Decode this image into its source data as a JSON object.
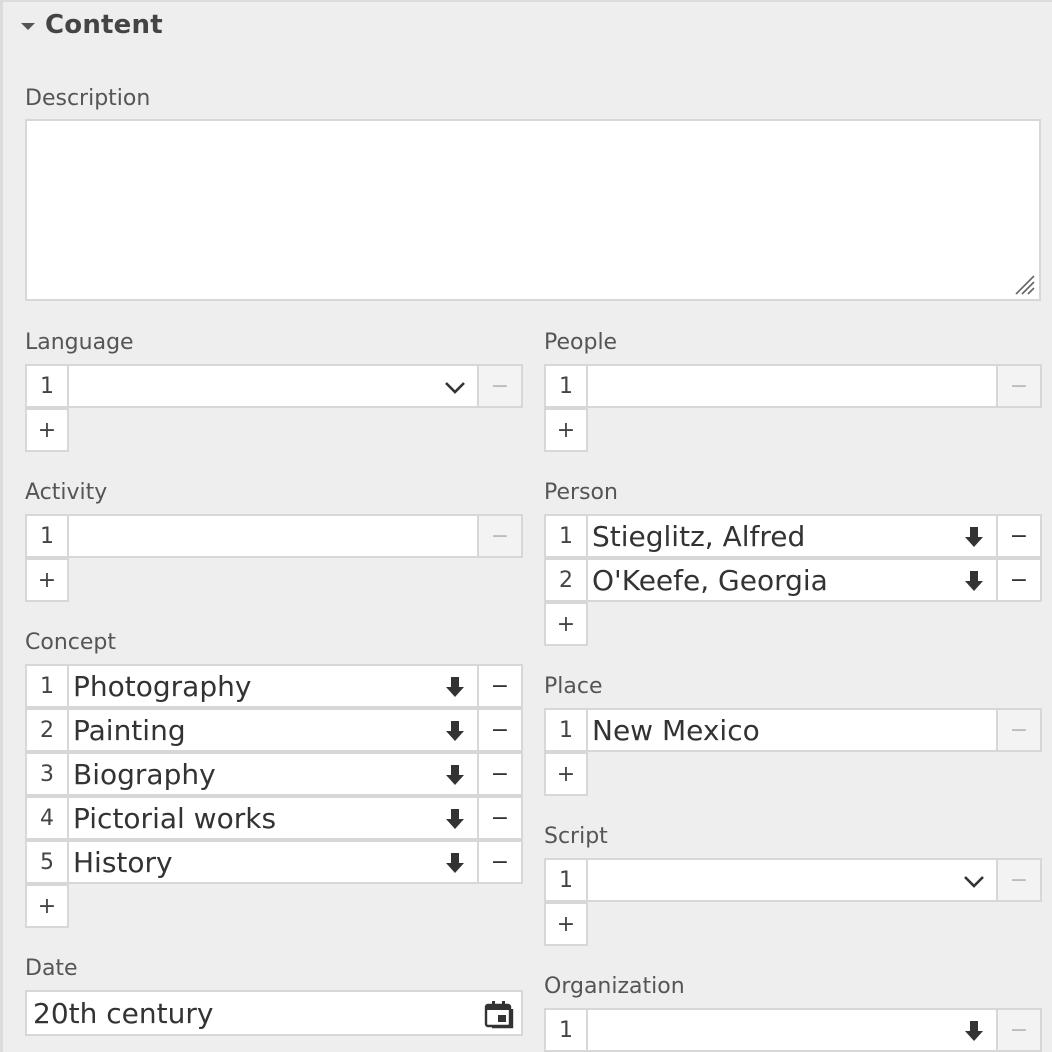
{
  "section": {
    "title": "Content"
  },
  "labels": {
    "description": "Description",
    "language": "Language",
    "people": "People",
    "activity": "Activity",
    "person": "Person",
    "concept": "Concept",
    "place": "Place",
    "script": "Script",
    "date": "Date",
    "organization": "Organization"
  },
  "description": {
    "value": ""
  },
  "language": {
    "rows": [
      {
        "n": "1",
        "value": ""
      }
    ],
    "add": "+",
    "remove": "−"
  },
  "people": {
    "rows": [
      {
        "n": "1",
        "value": ""
      }
    ],
    "add": "+",
    "remove": "−"
  },
  "activity": {
    "rows": [
      {
        "n": "1",
        "value": ""
      }
    ],
    "add": "+",
    "remove": "−"
  },
  "person": {
    "rows": [
      {
        "n": "1",
        "value": "Stieglitz, Alfred"
      },
      {
        "n": "2",
        "value": "O'Keefe, Georgia"
      }
    ],
    "add": "+",
    "remove": "−"
  },
  "concept": {
    "rows": [
      {
        "n": "1",
        "value": "Photography"
      },
      {
        "n": "2",
        "value": "Painting"
      },
      {
        "n": "3",
        "value": "Biography"
      },
      {
        "n": "4",
        "value": "Pictorial works"
      },
      {
        "n": "5",
        "value": "History"
      }
    ],
    "add": "+",
    "remove": "−"
  },
  "place": {
    "rows": [
      {
        "n": "1",
        "value": "New Mexico"
      }
    ],
    "add": "+",
    "remove": "−"
  },
  "script": {
    "rows": [
      {
        "n": "1",
        "value": ""
      }
    ],
    "add": "+",
    "remove": "−"
  },
  "date": {
    "value": "20th century"
  },
  "organization": {
    "rows": [
      {
        "n": "1",
        "value": ""
      }
    ],
    "remove": "−"
  },
  "icons": {
    "caret": "caret-down-icon",
    "dropdown": "chevron-down-icon",
    "autocomplete": "arrow-down-icon",
    "calendar": "calendar-icon"
  }
}
